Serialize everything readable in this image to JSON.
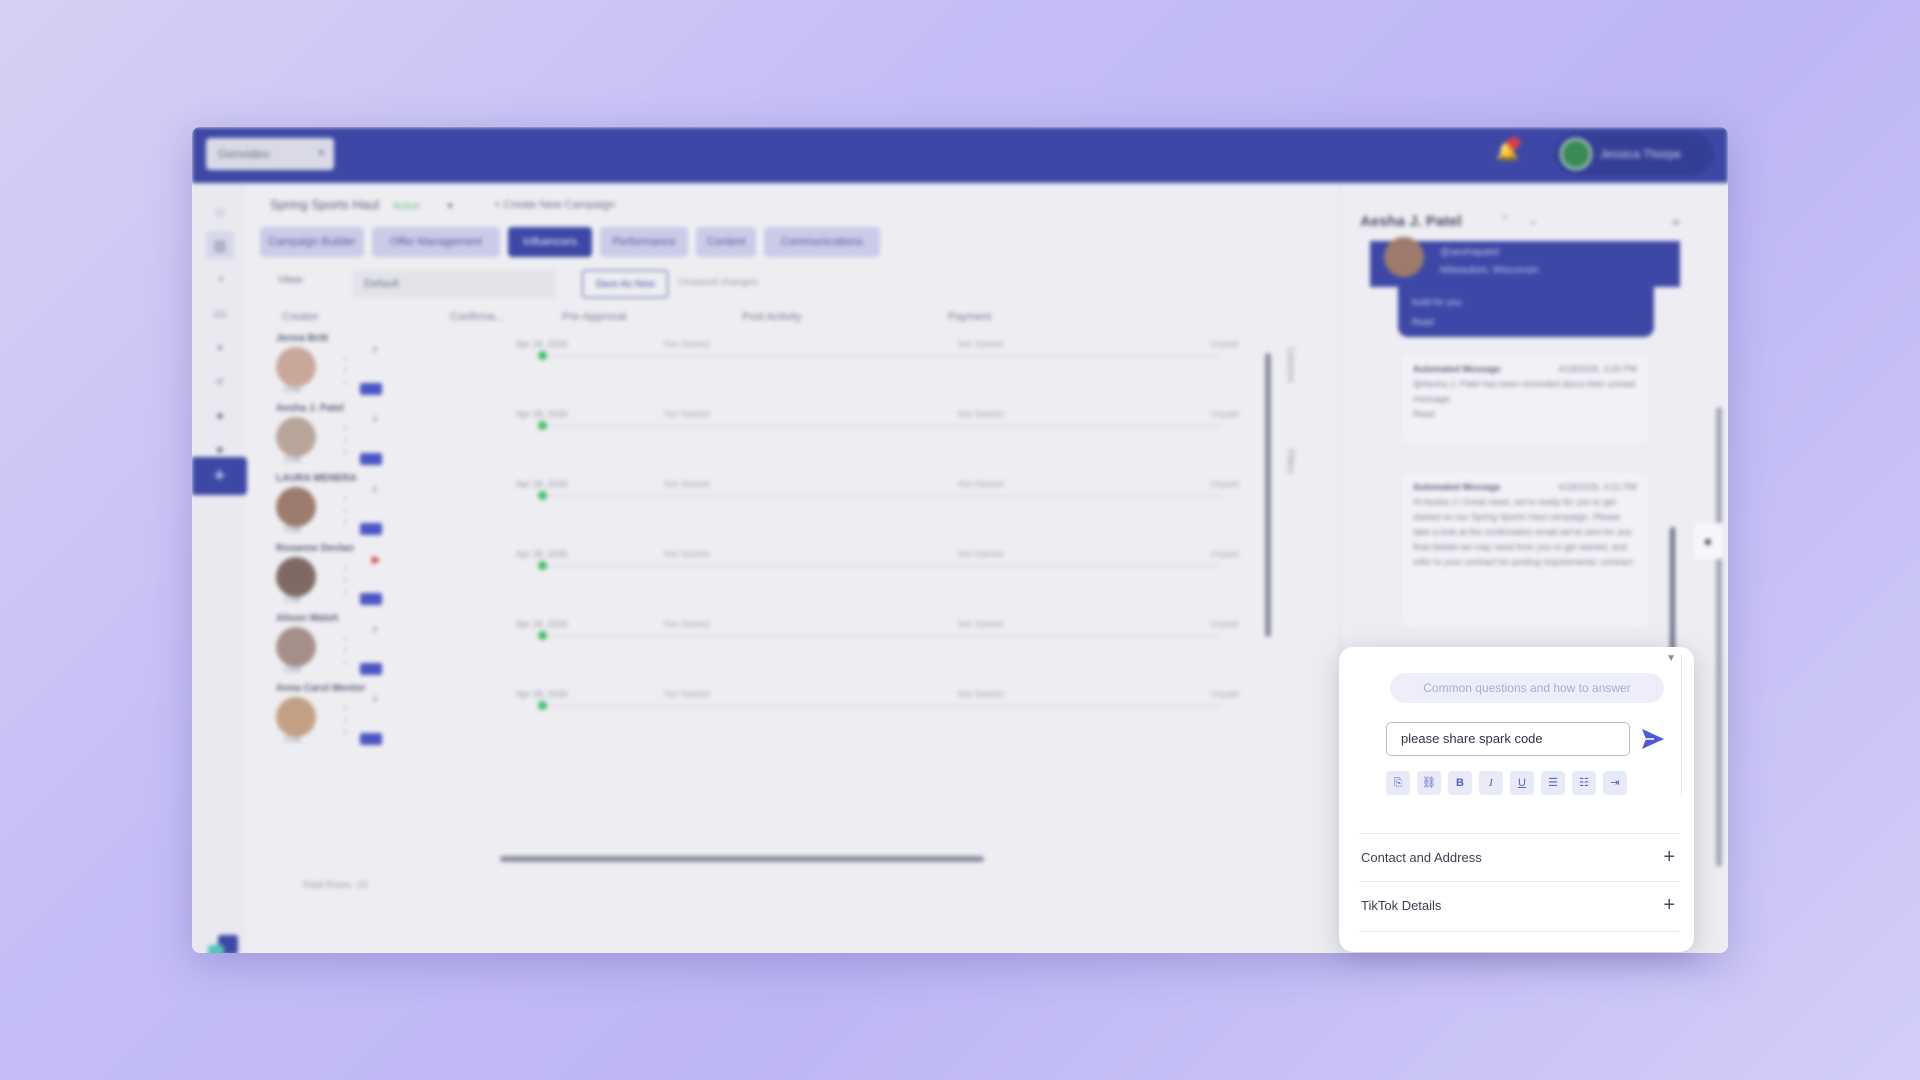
{
  "topbar": {
    "brand_select": "Genvideo",
    "user_name": "Jessica Thorpe"
  },
  "campaign": {
    "name": "Spring Sports Haul",
    "status": "Active",
    "create_label": "+ Create New Campaign"
  },
  "tabs": [
    {
      "label": "Campaign Builder"
    },
    {
      "label": "Offer Management"
    },
    {
      "label": "Influencers"
    },
    {
      "label": "Performance"
    },
    {
      "label": "Content"
    },
    {
      "label": "Communications"
    }
  ],
  "view": {
    "label": "View:",
    "value": "Default",
    "save_label": "Save As New",
    "unsaved_label": "Unsaved changes"
  },
  "grid": {
    "columns": [
      "Creator",
      "Confirma...",
      "Pre-Approval",
      "Post Activity",
      "Payment"
    ],
    "rows": [
      {
        "name": "Jenna Britt",
        "date": "Apr 18, 2026",
        "s1": "Not Started",
        "s2": "Not Started",
        "s3": "Unpaid"
      },
      {
        "name": "Aesha J. Patel",
        "date": "Apr 18, 2026",
        "s1": "Not Started",
        "s2": "Not Started",
        "s3": "Unpaid"
      },
      {
        "name": "LAURA MENERA",
        "date": "Apr 18, 2026",
        "s1": "Not Started",
        "s2": "Not Started",
        "s3": "Unpaid"
      },
      {
        "name": "Roxanne Devlan",
        "date": "Apr 18, 2026",
        "s1": "Not Started",
        "s2": "Not Started",
        "s3": "Unpaid"
      },
      {
        "name": "Alison Walsh",
        "date": "Apr 18, 2026",
        "s1": "Not Started",
        "s2": "Not Started",
        "s3": "Unpaid"
      },
      {
        "name": "Anna Carol Mentor",
        "date": "Apr 18, 2026",
        "s1": "Not Started",
        "s2": "Not Started",
        "s3": "Unpaid"
      }
    ],
    "chat_label": "Chat",
    "total_label": "Total Rows: 10",
    "side_columns": "Columns",
    "side_filters": "Filters"
  },
  "right_panel": {
    "name": "Aesha J. Patel",
    "handle": "@aeshapatel",
    "location": "Milwaukee, Wisconsin",
    "blue_msg": "build for you.",
    "blue_msg_status": "Read",
    "msg1_title": "Automated Message",
    "msg1_time": "4/18/2026, 3:20 PM",
    "msg1_body": "@Aesha J. Patel has been reminded about their unread message.",
    "msg1_status": "Read",
    "msg2_title": "Automated Message",
    "msg2_time": "4/18/2026, 3:21 PM",
    "msg2_body": "Hi Aesha J.! Great news, we're ready for you to get started on our Spring Sports Haul campaign. Please take a look at the confirmation email we've sent for any final details we may need from you to get started, and refer to your contract for posting requirements: contract"
  },
  "composer": {
    "faq_chip": "Common questions and how to answer",
    "input_value": "please share spark code",
    "toolbar": [
      "attach-icon",
      "link-icon",
      "bold-icon",
      "italic-icon",
      "underline-icon",
      "bullet-list-icon",
      "numbered-list-icon",
      "indent-icon"
    ]
  },
  "accordion": [
    {
      "label": "Contact and Address"
    },
    {
      "label": "TikTok Details"
    }
  ],
  "colors": {
    "primary": "#3d48a6",
    "send": "#4a5bd4",
    "success": "#3fbf6a"
  }
}
